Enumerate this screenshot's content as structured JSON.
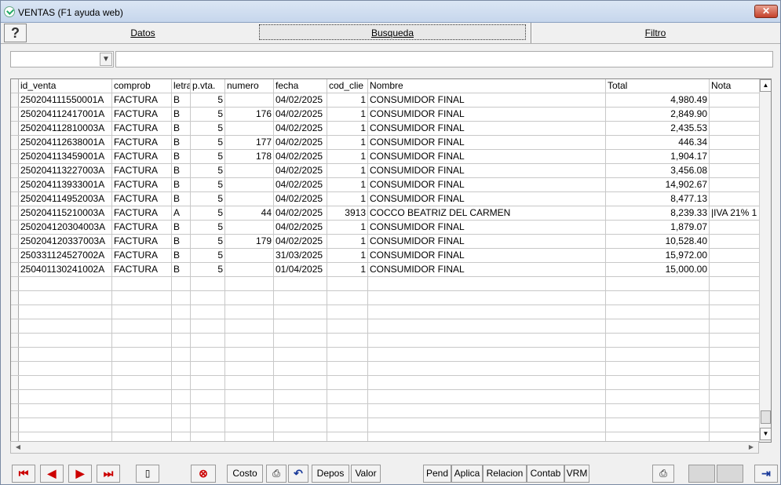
{
  "window": {
    "title": "VENTAS (F1 ayuda web)",
    "close_label": "✕"
  },
  "tabs": [
    {
      "label": "Datos"
    },
    {
      "label": "Busqueda"
    },
    {
      "label": "Filtro"
    }
  ],
  "help_label": "?",
  "columns": [
    "id_venta",
    "comprob",
    "letra",
    "p.vta.",
    "numero",
    "fecha",
    "cod_clie",
    "Nombre",
    "Total",
    "Nota"
  ],
  "rows": [
    [
      "250204111550001A",
      "FACTURA",
      "B",
      "5",
      "",
      "04/02/2025",
      "1",
      "CONSUMIDOR FINAL",
      "4,980.49",
      ""
    ],
    [
      "250204112417001A",
      "FACTURA",
      "B",
      "5",
      "176",
      "04/02/2025",
      "1",
      "CONSUMIDOR FINAL",
      "2,849.90",
      ""
    ],
    [
      "250204112810003A",
      "FACTURA",
      "B",
      "5",
      "",
      "04/02/2025",
      "1",
      "CONSUMIDOR FINAL",
      "2,435.53",
      ""
    ],
    [
      "250204112638001A",
      "FACTURA",
      "B",
      "5",
      "177",
      "04/02/2025",
      "1",
      "CONSUMIDOR FINAL",
      "446.34",
      ""
    ],
    [
      "250204113459001A",
      "FACTURA",
      "B",
      "5",
      "178",
      "04/02/2025",
      "1",
      "CONSUMIDOR FINAL",
      "1,904.17",
      ""
    ],
    [
      "250204113227003A",
      "FACTURA",
      "B",
      "5",
      "",
      "04/02/2025",
      "1",
      "CONSUMIDOR FINAL",
      "3,456.08",
      ""
    ],
    [
      "250204113933001A",
      "FACTURA",
      "B",
      "5",
      "",
      "04/02/2025",
      "1",
      "CONSUMIDOR FINAL",
      "14,902.67",
      ""
    ],
    [
      "250204114952003A",
      "FACTURA",
      "B",
      "5",
      "",
      "04/02/2025",
      "1",
      "CONSUMIDOR FINAL",
      "8,477.13",
      ""
    ],
    [
      "250204115210003A",
      "FACTURA",
      "A",
      "5",
      "44",
      "04/02/2025",
      "3913",
      "COCCO BEATRIZ DEL CARMEN",
      "8,239.33",
      "|IVA 21% 1"
    ],
    [
      "250204120304003A",
      "FACTURA",
      "B",
      "5",
      "",
      "04/02/2025",
      "1",
      "CONSUMIDOR FINAL",
      "1,879.07",
      ""
    ],
    [
      "250204120337003A",
      "FACTURA",
      "B",
      "5",
      "179",
      "04/02/2025",
      "1",
      "CONSUMIDOR FINAL",
      "10,528.40",
      ""
    ],
    [
      "250331124527002A",
      "FACTURA",
      "B",
      "5",
      "",
      "31/03/2025",
      "1",
      "CONSUMIDOR FINAL",
      "15,972.00",
      ""
    ],
    [
      "250401130241002A",
      "FACTURA",
      "B",
      "5",
      "",
      "01/04/2025",
      "1",
      "CONSUMIDOR FINAL",
      "15,000.00",
      ""
    ]
  ],
  "empty_rows": 13,
  "toolbar": {
    "costo": "Costo",
    "depos": "Depos",
    "valor": "Valor",
    "pend": "Pend",
    "aplica": "Aplica",
    "relacion": "Relacion",
    "contab": "Contab",
    "vrm": "VRM"
  },
  "icons": [
    "first-record-icon",
    "prev-record-icon",
    "next-record-icon",
    "last-record-icon",
    "new-document-icon",
    "delete-icon",
    "print-icon",
    "undo-icon",
    "exit-icon"
  ]
}
